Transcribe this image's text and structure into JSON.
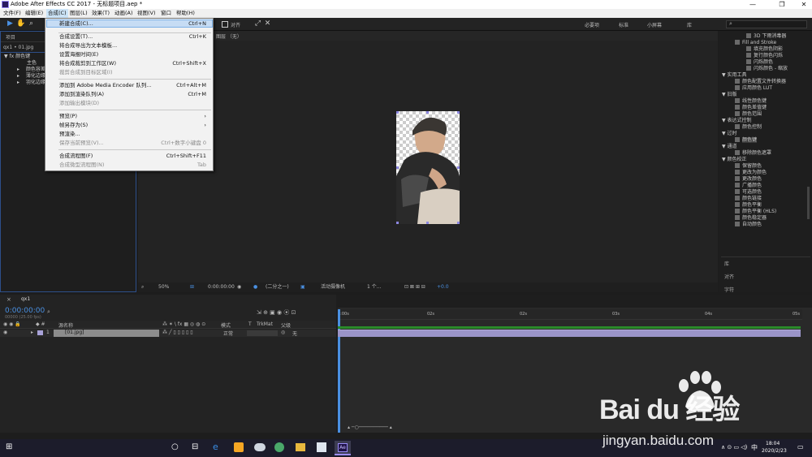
{
  "window": {
    "title": "Adobe After Effects CC 2017 - 无标题项目.aep *"
  },
  "menubar": [
    "文件(F)",
    "编辑(E)",
    "合成(C)",
    "图层(L)",
    "效果(T)",
    "动画(A)",
    "视图(V)",
    "窗口",
    "帮助(H)"
  ],
  "toolbar": {
    "align_label": "对齐",
    "workspaces": [
      "必要项",
      "标准",
      "小屏幕",
      "库"
    ]
  },
  "dropdown": {
    "items": [
      {
        "label": "新建合成(C)...",
        "shortcut": "Ctrl+N"
      },
      {
        "label": "合成设置(T)...",
        "shortcut": "Ctrl+K"
      },
      {
        "label": "将合成导出为文本模板...",
        "shortcut": ""
      },
      {
        "label": "设置海报时间(E)",
        "shortcut": ""
      },
      {
        "label": "将合成裁剪到工作区(W)",
        "shortcut": "Ctrl+Shift+X"
      },
      {
        "label": "裁剪合成到目标区域(I)",
        "shortcut": ""
      },
      {
        "label": "添加到 Adobe Media Encoder 队列...",
        "shortcut": "Ctrl+Alt+M"
      },
      {
        "label": "添加到渲染队列(A)",
        "shortcut": "Ctrl+M"
      },
      {
        "label": "添加输出模块(D)",
        "shortcut": ""
      },
      {
        "label": "预览(P)",
        "shortcut": "›"
      },
      {
        "label": "帧另存为(S)",
        "shortcut": "›"
      },
      {
        "label": "预渲染...",
        "shortcut": ""
      },
      {
        "label": "保存当前预览(V)...",
        "shortcut": "Ctrl+数字小键盘 0"
      },
      {
        "label": "合成流程图(F)",
        "shortcut": "Ctrl+Shift+F11"
      },
      {
        "label": "合成微型流程图(N)",
        "shortcut": "Tab"
      }
    ]
  },
  "project": {
    "tab": "项目",
    "file": "qx1 • 01.jpg",
    "tree": [
      "▼ fx  颜色键",
      "主色",
      "颜色容差",
      "薄化边缘",
      "羽化边缘"
    ]
  },
  "viewer": {
    "header_label": "图层 （无）",
    "zoom": "50%",
    "timecode": "0:00:00:00",
    "resolution": "(二分之一)",
    "camera": "活动摄像机",
    "views": "1 个...",
    "exposure": "+0.0"
  },
  "effects_panel": {
    "items": [
      "3D 下雨消毒器",
      "Fill and Stroke",
      "填充颜色阴影",
      "复行颜色闪烁",
      "闪烁颜色",
      "闪烁颜色 - 缩放",
      "▼ 实用工具",
      "颜色配置文件转换器",
      "应用颜色 LUT",
      "▼ 旧版",
      "线性颜色键",
      "颜色差值键",
      "颜色范围",
      "▼ 表达式控制",
      "颜色控制",
      "▼ 过时",
      "颜色键",
      "▼ 通道",
      "移除颜色遮罩",
      "▼ 颜色校正",
      "保留颜色",
      "更改为颜色",
      "更改颜色",
      "广播颜色",
      "可选颜色",
      "颜色链接",
      "颜色平衡",
      "颜色平衡 (HLS)",
      "颜色稳定器",
      "自动颜色"
    ],
    "lower_tabs": [
      "库",
      "对齐",
      "字符"
    ]
  },
  "timeline": {
    "comp_tab": "qx1",
    "timecode": "0:00:00:00",
    "fps": "00000 (25.00 fps)",
    "columns": [
      "源名称",
      "模式",
      "T",
      "TrkMat",
      "父级"
    ],
    "layer": {
      "index": "1",
      "name": "[01.jpg]",
      "mode": "正常",
      "parent": "无"
    },
    "ticks": [
      "0:00s",
      "02s",
      "02s",
      "03s",
      "04s",
      "05s"
    ]
  },
  "taskbar": {
    "time": "18:04",
    "date": "2020/2/23",
    "ime": "中"
  },
  "watermark": {
    "brand": "Bai du 经验",
    "url": "jingyan.baidu.com"
  }
}
